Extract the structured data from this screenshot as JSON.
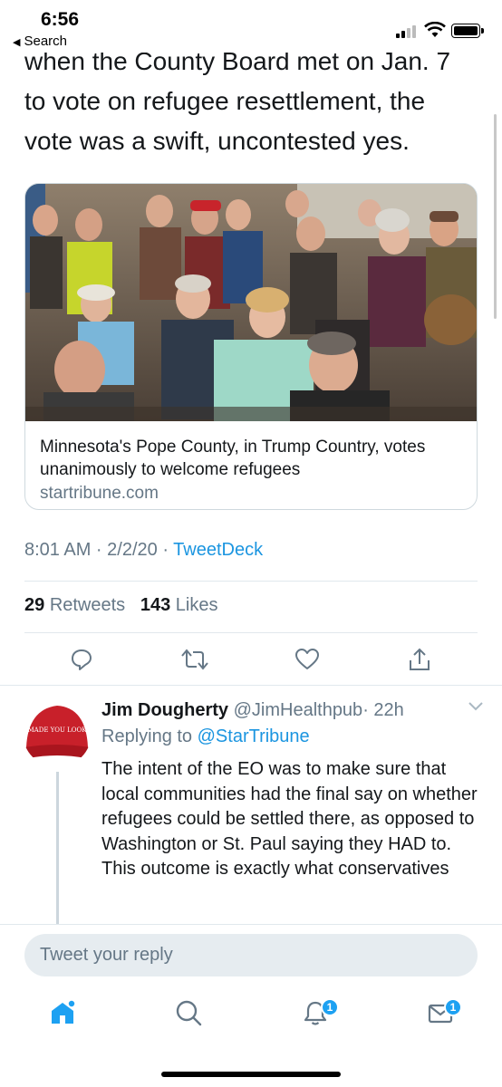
{
  "status_bar": {
    "time": "6:56",
    "back_label": "Search"
  },
  "tweet": {
    "text": "when the County Board met on Jan. 7 to vote on refugee resettlement, the vote was a swift, uncontested yes.",
    "card": {
      "title": "Minnesota's Pope County, in Trump Country, votes unanimously to welcome refugees",
      "domain": "startribune.com"
    },
    "timestamp": "8:01 AM · 2/2/20 · ",
    "source": "TweetDeck",
    "retweets_count": "29",
    "retweets_label": "Retweets",
    "likes_count": "143",
    "likes_label": "Likes",
    "actions": [
      "reply-icon",
      "retweet-icon",
      "like-icon",
      "share-icon"
    ]
  },
  "reply": {
    "name": "Jim Dougherty",
    "handle": "@JimHealthpub",
    "time": "· 22h",
    "replying_prefix": "Replying to",
    "replying_to": "@StarTribune",
    "text": "The intent of the EO was to make sure that local communities had the final say on whether refugees could be settled there, as opposed to Washington or St. Paul saying they HAD to.  This outcome is exactly what conservatives want, local control.",
    "avatar_text": "MADE YOU LOOK"
  },
  "compose": {
    "placeholder": "Tweet your reply"
  },
  "tab_bar": {
    "items": [
      "home-icon",
      "search-icon",
      "notifications-icon",
      "messages-icon"
    ],
    "notifications_badge": "1",
    "messages_badge": "1"
  },
  "colors": {
    "accent": "#1da1f2",
    "link": "#1b95e0",
    "secondary_text": "#657786"
  }
}
